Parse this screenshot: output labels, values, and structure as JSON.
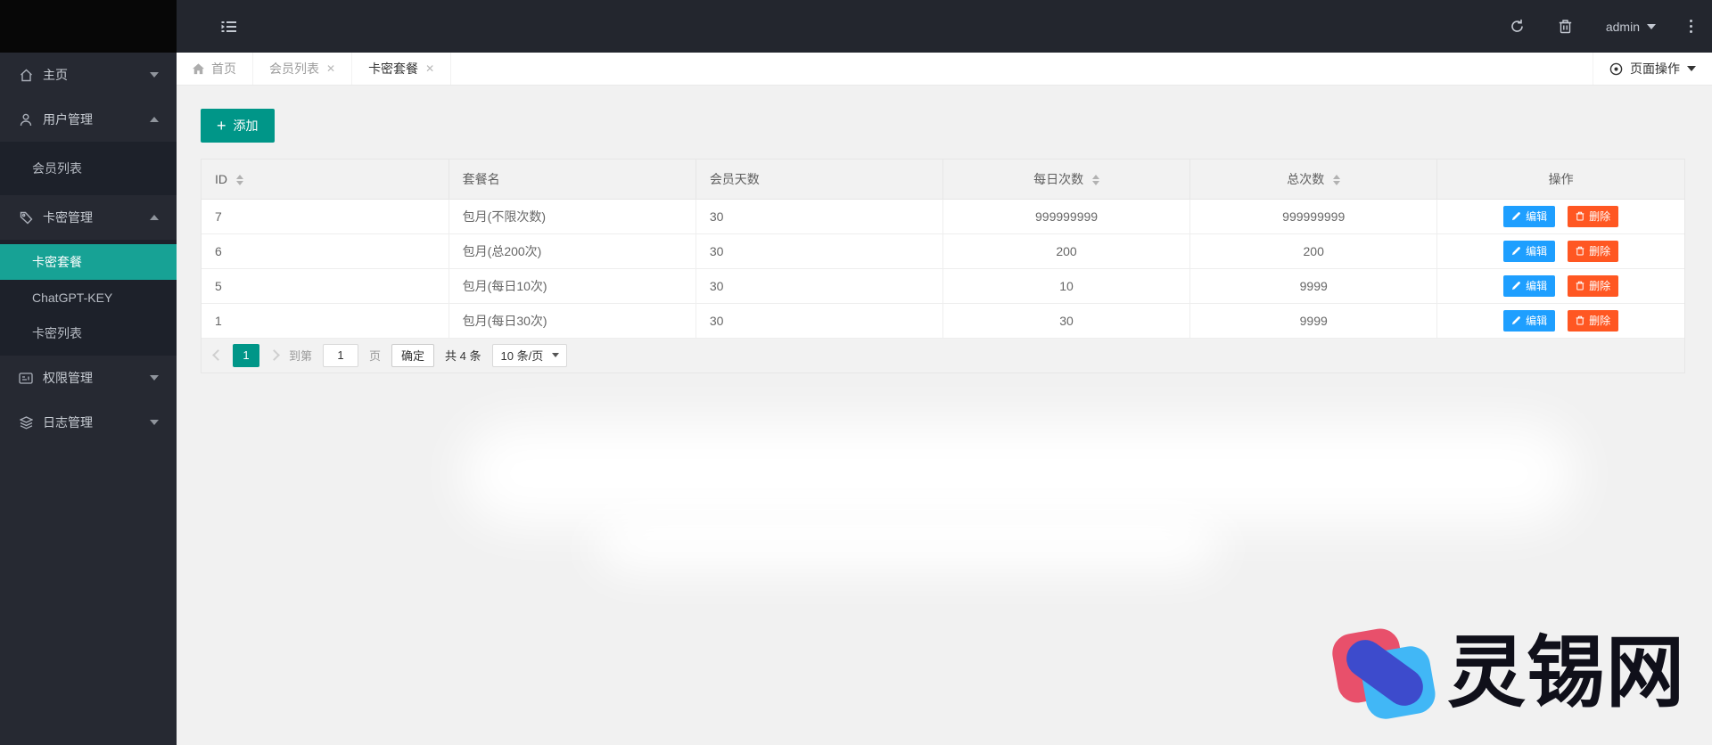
{
  "topbar": {
    "collapse_icon": "menu-collapse-icon",
    "icons": [
      "refresh-icon",
      "trash-icon",
      "more-vertical-icon"
    ],
    "username": "admin"
  },
  "sidebar": {
    "items": [
      {
        "label": "主页",
        "icon": "home-icon",
        "state": "collapsed"
      },
      {
        "label": "用户管理",
        "icon": "user-icon",
        "state": "expanded",
        "children": [
          {
            "label": "会员列表",
            "active": false
          }
        ]
      },
      {
        "label": "卡密管理",
        "icon": "tag-icon",
        "state": "expanded",
        "children": [
          {
            "label": "卡密套餐",
            "active": true
          },
          {
            "label": "ChatGPT-KEY",
            "active": false
          },
          {
            "label": "卡密列表",
            "active": false
          }
        ]
      },
      {
        "label": "权限管理",
        "icon": "id-card-icon",
        "state": "collapsed"
      },
      {
        "label": "日志管理",
        "icon": "layers-icon",
        "state": "collapsed"
      }
    ]
  },
  "tabs": [
    {
      "label": "首页",
      "icon": "home-icon",
      "closable": false,
      "active": false
    },
    {
      "label": "会员列表",
      "closable": true,
      "active": false
    },
    {
      "label": "卡密套餐",
      "closable": true,
      "active": true
    }
  ],
  "page_ops": {
    "label": "页面操作",
    "icon": "target-circle-icon"
  },
  "toolbar": {
    "add_label": "添加"
  },
  "table": {
    "columns": [
      {
        "label": "ID",
        "sortable": true,
        "align": "left"
      },
      {
        "label": "套餐名",
        "sortable": false,
        "align": "left"
      },
      {
        "label": "会员天数",
        "sortable": false,
        "align": "left"
      },
      {
        "label": "每日次数",
        "sortable": true,
        "align": "center"
      },
      {
        "label": "总次数",
        "sortable": true,
        "align": "center"
      },
      {
        "label": "操作",
        "sortable": false,
        "align": "center"
      }
    ],
    "rows": [
      {
        "id": "7",
        "name": "包月(不限次数)",
        "days": "30",
        "daily": "999999999",
        "total": "999999999"
      },
      {
        "id": "6",
        "name": "包月(总200次)",
        "days": "30",
        "daily": "200",
        "total": "200"
      },
      {
        "id": "5",
        "name": "包月(每日10次)",
        "days": "30",
        "daily": "10",
        "total": "9999"
      },
      {
        "id": "1",
        "name": "包月(每日30次)",
        "days": "30",
        "daily": "30",
        "total": "9999"
      }
    ],
    "row_actions": {
      "edit": "编辑",
      "delete": "删除"
    }
  },
  "pagination": {
    "current": "1",
    "goto_label": "到第",
    "goto_value": "1",
    "page_label": "页",
    "confirm_label": "确定",
    "total_label": "共 4 条",
    "page_size": "10 条/页"
  },
  "watermark": {
    "text": "灵锡网"
  },
  "colors": {
    "accent_teal": "#009688",
    "sidebar_active": "#17A295",
    "edit_blue": "#1E9FFF",
    "delete_orange": "#FF5722",
    "topbar_bg": "#23262E"
  }
}
